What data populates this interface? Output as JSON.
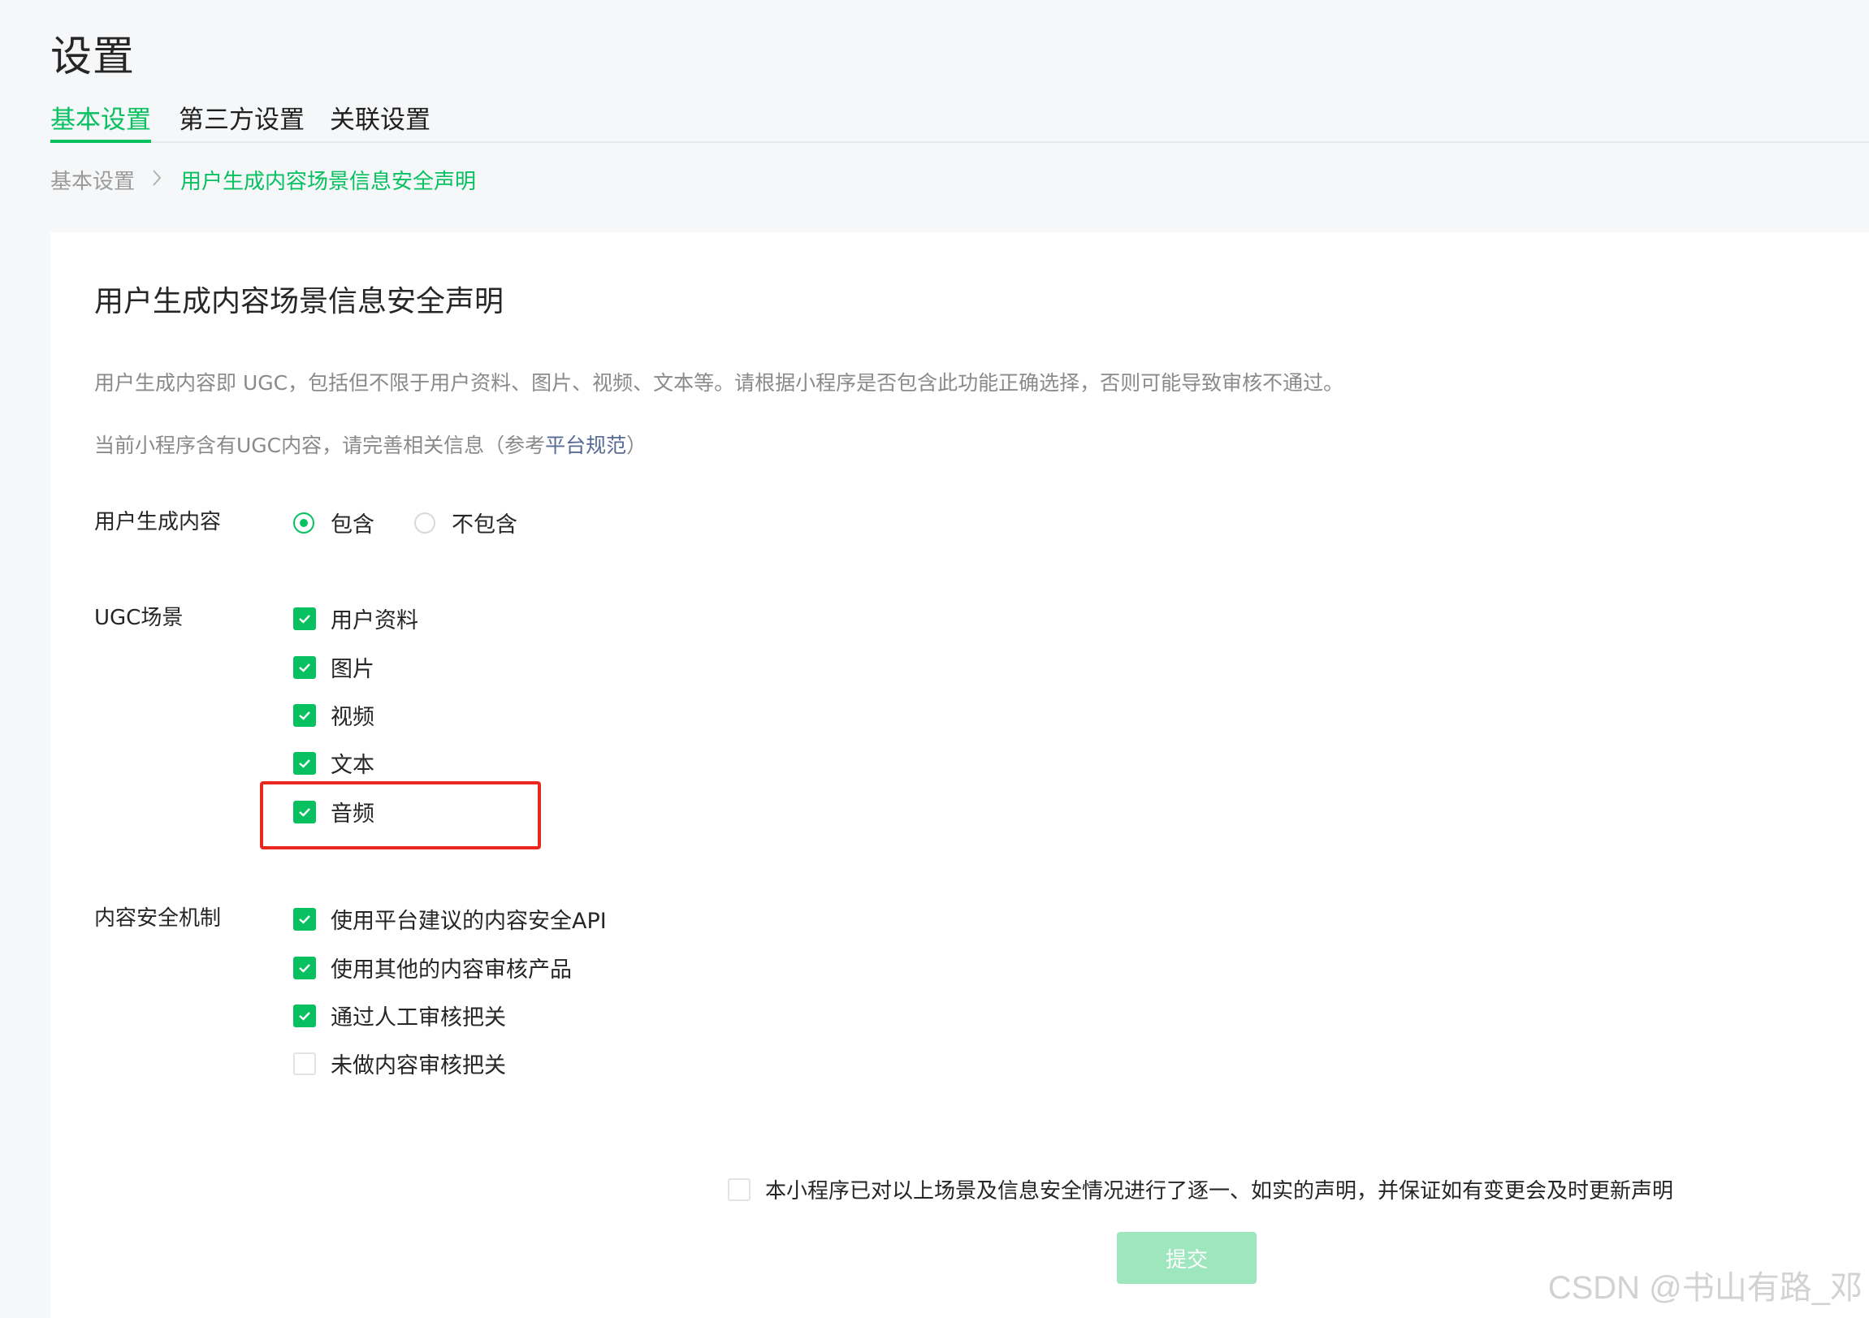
{
  "page": {
    "title": "设置"
  },
  "tabs": [
    {
      "label": "基本设置",
      "active": true
    },
    {
      "label": "第三方设置",
      "active": false
    },
    {
      "label": "关联设置",
      "active": false
    }
  ],
  "breadcrumb": {
    "root": "基本设置",
    "separator": ">",
    "current": "用户生成内容场景信息安全声明"
  },
  "card": {
    "title": "用户生成内容场景信息安全声明",
    "description": "用户生成内容即 UGC，包括但不限于用户资料、图片、视频、文本等。请根据小程序是否包含此功能正确选择，否则可能导致审核不通过。",
    "note_prefix": "当前小程序含有UGC内容，请完善相关信息（参考",
    "note_link": "平台规范",
    "note_suffix": "）"
  },
  "ugc_field": {
    "label": "用户生成内容",
    "options": [
      {
        "label": "包含",
        "selected": true
      },
      {
        "label": "不包含",
        "selected": false
      }
    ]
  },
  "scene_field": {
    "label": "UGC场景",
    "options": [
      {
        "label": "用户资料",
        "checked": true
      },
      {
        "label": "图片",
        "checked": true
      },
      {
        "label": "视频",
        "checked": true
      },
      {
        "label": "文本",
        "checked": true
      },
      {
        "label": "音频",
        "checked": true
      }
    ]
  },
  "mechanism_field": {
    "label": "内容安全机制",
    "options": [
      {
        "label": "使用平台建议的内容安全API",
        "checked": true
      },
      {
        "label": "使用其他的内容审核产品",
        "checked": true
      },
      {
        "label": "通过人工审核把关",
        "checked": true
      },
      {
        "label": "未做内容审核把关",
        "checked": false
      }
    ]
  },
  "declaration": {
    "label": "本小程序已对以上场景及信息安全情况进行了逐一、如实的声明，并保证如有变更会及时更新声明",
    "checked": false
  },
  "submit": {
    "label": "提交",
    "enabled": false
  },
  "watermark": "CSDN @书山有路_邓",
  "colors": {
    "accent": "#07c160",
    "link": "#576b95",
    "annotation": "#e8271f",
    "disabled_button": "#9ee6bd"
  }
}
